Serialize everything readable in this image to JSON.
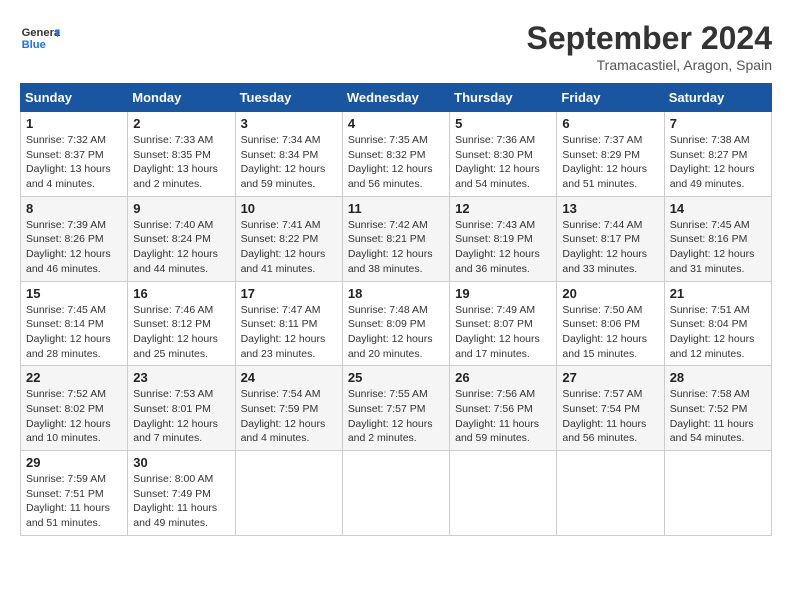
{
  "header": {
    "logo_general": "General",
    "logo_blue": "Blue",
    "month_year": "September 2024",
    "location": "Tramacastiel, Aragon, Spain"
  },
  "calendar": {
    "days_of_week": [
      "Sunday",
      "Monday",
      "Tuesday",
      "Wednesday",
      "Thursday",
      "Friday",
      "Saturday"
    ],
    "weeks": [
      [
        {
          "day": "1",
          "info": "Sunrise: 7:32 AM\nSunset: 8:37 PM\nDaylight: 13 hours\nand 4 minutes."
        },
        {
          "day": "2",
          "info": "Sunrise: 7:33 AM\nSunset: 8:35 PM\nDaylight: 13 hours\nand 2 minutes."
        },
        {
          "day": "3",
          "info": "Sunrise: 7:34 AM\nSunset: 8:34 PM\nDaylight: 12 hours\nand 59 minutes."
        },
        {
          "day": "4",
          "info": "Sunrise: 7:35 AM\nSunset: 8:32 PM\nDaylight: 12 hours\nand 56 minutes."
        },
        {
          "day": "5",
          "info": "Sunrise: 7:36 AM\nSunset: 8:30 PM\nDaylight: 12 hours\nand 54 minutes."
        },
        {
          "day": "6",
          "info": "Sunrise: 7:37 AM\nSunset: 8:29 PM\nDaylight: 12 hours\nand 51 minutes."
        },
        {
          "day": "7",
          "info": "Sunrise: 7:38 AM\nSunset: 8:27 PM\nDaylight: 12 hours\nand 49 minutes."
        }
      ],
      [
        {
          "day": "8",
          "info": "Sunrise: 7:39 AM\nSunset: 8:26 PM\nDaylight: 12 hours\nand 46 minutes."
        },
        {
          "day": "9",
          "info": "Sunrise: 7:40 AM\nSunset: 8:24 PM\nDaylight: 12 hours\nand 44 minutes."
        },
        {
          "day": "10",
          "info": "Sunrise: 7:41 AM\nSunset: 8:22 PM\nDaylight: 12 hours\nand 41 minutes."
        },
        {
          "day": "11",
          "info": "Sunrise: 7:42 AM\nSunset: 8:21 PM\nDaylight: 12 hours\nand 38 minutes."
        },
        {
          "day": "12",
          "info": "Sunrise: 7:43 AM\nSunset: 8:19 PM\nDaylight: 12 hours\nand 36 minutes."
        },
        {
          "day": "13",
          "info": "Sunrise: 7:44 AM\nSunset: 8:17 PM\nDaylight: 12 hours\nand 33 minutes."
        },
        {
          "day": "14",
          "info": "Sunrise: 7:45 AM\nSunset: 8:16 PM\nDaylight: 12 hours\nand 31 minutes."
        }
      ],
      [
        {
          "day": "15",
          "info": "Sunrise: 7:45 AM\nSunset: 8:14 PM\nDaylight: 12 hours\nand 28 minutes."
        },
        {
          "day": "16",
          "info": "Sunrise: 7:46 AM\nSunset: 8:12 PM\nDaylight: 12 hours\nand 25 minutes."
        },
        {
          "day": "17",
          "info": "Sunrise: 7:47 AM\nSunset: 8:11 PM\nDaylight: 12 hours\nand 23 minutes."
        },
        {
          "day": "18",
          "info": "Sunrise: 7:48 AM\nSunset: 8:09 PM\nDaylight: 12 hours\nand 20 minutes."
        },
        {
          "day": "19",
          "info": "Sunrise: 7:49 AM\nSunset: 8:07 PM\nDaylight: 12 hours\nand 17 minutes."
        },
        {
          "day": "20",
          "info": "Sunrise: 7:50 AM\nSunset: 8:06 PM\nDaylight: 12 hours\nand 15 minutes."
        },
        {
          "day": "21",
          "info": "Sunrise: 7:51 AM\nSunset: 8:04 PM\nDaylight: 12 hours\nand 12 minutes."
        }
      ],
      [
        {
          "day": "22",
          "info": "Sunrise: 7:52 AM\nSunset: 8:02 PM\nDaylight: 12 hours\nand 10 minutes."
        },
        {
          "day": "23",
          "info": "Sunrise: 7:53 AM\nSunset: 8:01 PM\nDaylight: 12 hours\nand 7 minutes."
        },
        {
          "day": "24",
          "info": "Sunrise: 7:54 AM\nSunset: 7:59 PM\nDaylight: 12 hours\nand 4 minutes."
        },
        {
          "day": "25",
          "info": "Sunrise: 7:55 AM\nSunset: 7:57 PM\nDaylight: 12 hours\nand 2 minutes."
        },
        {
          "day": "26",
          "info": "Sunrise: 7:56 AM\nSunset: 7:56 PM\nDaylight: 11 hours\nand 59 minutes."
        },
        {
          "day": "27",
          "info": "Sunrise: 7:57 AM\nSunset: 7:54 PM\nDaylight: 11 hours\nand 56 minutes."
        },
        {
          "day": "28",
          "info": "Sunrise: 7:58 AM\nSunset: 7:52 PM\nDaylight: 11 hours\nand 54 minutes."
        }
      ],
      [
        {
          "day": "29",
          "info": "Sunrise: 7:59 AM\nSunset: 7:51 PM\nDaylight: 11 hours\nand 51 minutes."
        },
        {
          "day": "30",
          "info": "Sunrise: 8:00 AM\nSunset: 7:49 PM\nDaylight: 11 hours\nand 49 minutes."
        },
        {
          "day": "",
          "info": ""
        },
        {
          "day": "",
          "info": ""
        },
        {
          "day": "",
          "info": ""
        },
        {
          "day": "",
          "info": ""
        },
        {
          "day": "",
          "info": ""
        }
      ]
    ]
  }
}
